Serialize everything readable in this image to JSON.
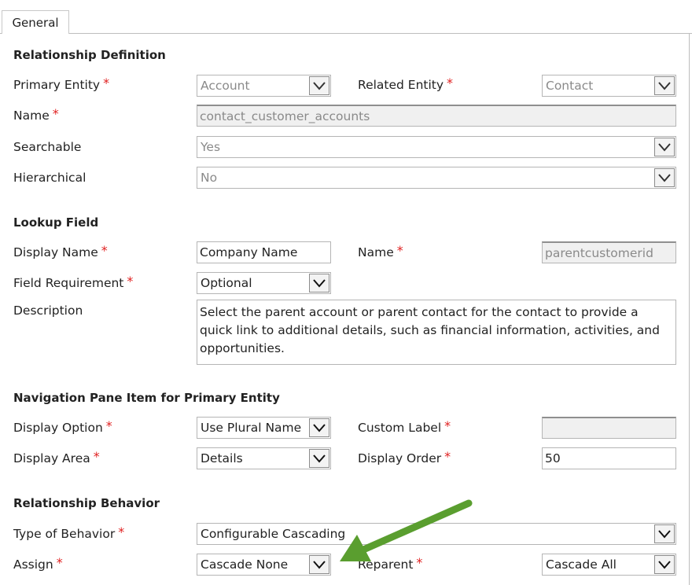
{
  "tab": {
    "label": "General"
  },
  "relationship_definition": {
    "heading": "Relationship Definition",
    "primary_entity": {
      "label": "Primary Entity",
      "value": "Account"
    },
    "related_entity": {
      "label": "Related Entity",
      "value": "Contact"
    },
    "name": {
      "label": "Name",
      "value": "contact_customer_accounts"
    },
    "searchable": {
      "label": "Searchable",
      "value": "Yes"
    },
    "hierarchical": {
      "label": "Hierarchical",
      "value": "No"
    }
  },
  "lookup_field": {
    "heading": "Lookup Field",
    "display_name": {
      "label": "Display Name",
      "value": "Company Name"
    },
    "name": {
      "label": "Name",
      "value": "parentcustomerid"
    },
    "field_requirement": {
      "label": "Field Requirement",
      "value": "Optional"
    },
    "description": {
      "label": "Description",
      "value": "Select the parent account or parent contact for the contact to provide a quick link to additional details, such as financial information, activities, and opportunities."
    }
  },
  "navigation_pane": {
    "heading": "Navigation Pane Item for Primary Entity",
    "display_option": {
      "label": "Display Option",
      "value": "Use Plural Name"
    },
    "custom_label": {
      "label": "Custom Label",
      "value": ""
    },
    "display_area": {
      "label": "Display Area",
      "value": "Details"
    },
    "display_order": {
      "label": "Display Order",
      "value": "50"
    }
  },
  "relationship_behavior": {
    "heading": "Relationship Behavior",
    "type_of_behavior": {
      "label": "Type of Behavior",
      "value": "Configurable Cascading"
    },
    "assign": {
      "label": "Assign",
      "value": "Cascade None"
    },
    "reparent": {
      "label": "Reparent",
      "value": "Cascade All"
    }
  },
  "required_marker": "*",
  "colors": {
    "required": "#e02020",
    "arrow": "#5a9e2f"
  }
}
